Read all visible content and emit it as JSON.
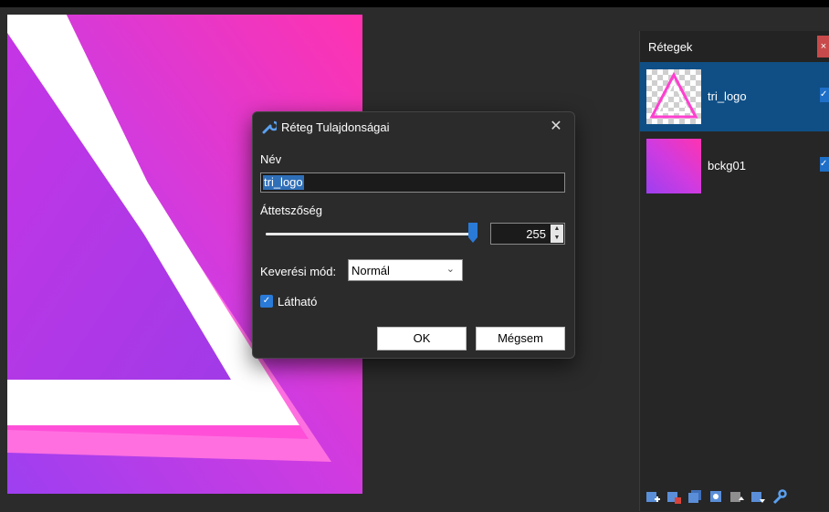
{
  "colors": {
    "accent": "#1e6fc7",
    "selected_row": "#0f4f86",
    "canvas_pink": "#ff3ebd",
    "canvas_purple": "#a83ae8"
  },
  "layers_panel": {
    "title": "Rétegek",
    "close_label": "×",
    "layers": [
      {
        "name": "tri_logo",
        "visible": true,
        "selected": true
      },
      {
        "name": "bckg01",
        "visible": true,
        "selected": false
      }
    ],
    "toolbar_icons": [
      "add-layer-icon",
      "delete-layer-icon",
      "duplicate-layer-icon",
      "merge-layer-icon",
      "move-layer-up-icon",
      "move-layer-down-icon",
      "layer-properties-icon"
    ]
  },
  "dialog": {
    "title": "Réteg Tulajdonságai",
    "close_label": "✕",
    "name_label": "Név",
    "name_value": "tri_logo",
    "opacity_label": "Áttetszőség",
    "opacity_value": "255",
    "opacity_max": 255,
    "blend_label": "Keverési mód:",
    "blend_value": "Normál",
    "visible_label": "Látható",
    "visible_checked": true,
    "ok_label": "OK",
    "cancel_label": "Mégsem"
  }
}
